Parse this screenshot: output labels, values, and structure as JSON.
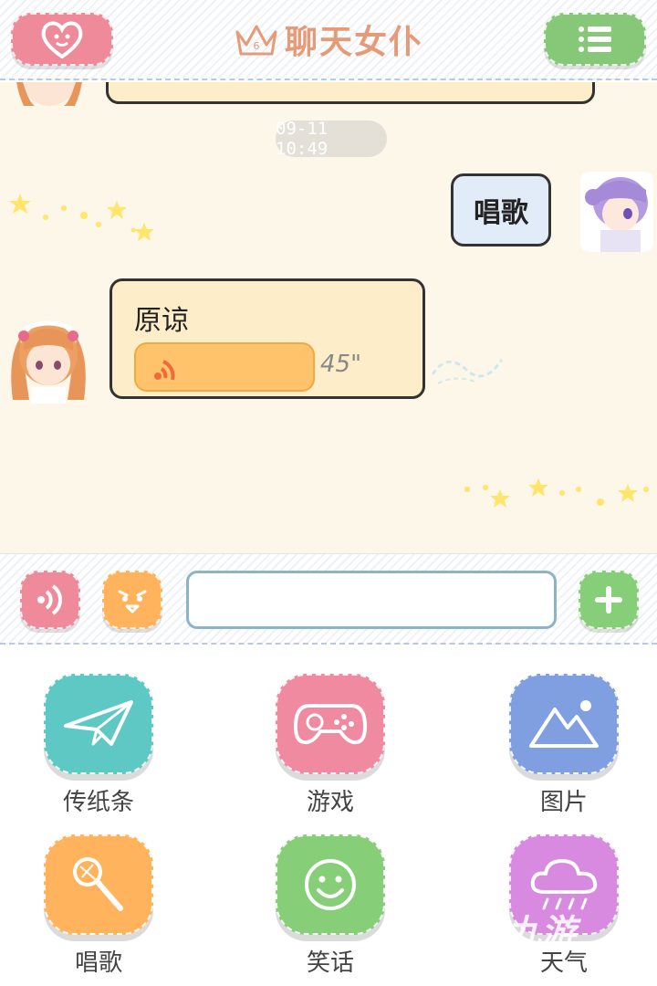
{
  "header": {
    "title": "聊天女仆",
    "crown_number": "6",
    "left_button_icon": "heart-face-icon",
    "right_button_icon": "menu-list-icon"
  },
  "chat": {
    "timestamp": "09-11 10:49",
    "messages": [
      {
        "from": "user",
        "text": "唱歌"
      },
      {
        "from": "maid",
        "text": "原谅",
        "voice_duration": "45\""
      }
    ]
  },
  "input_bar": {
    "voice_icon": "voice-wave-icon",
    "emoji_icon": "smiley-face-icon",
    "input_value": "",
    "plus_icon": "plus-icon"
  },
  "functions": [
    {
      "label": "传纸条",
      "icon": "paper-plane-icon",
      "color": "#5ec8c4"
    },
    {
      "label": "游戏",
      "icon": "gamepad-icon",
      "color": "#f08aa0"
    },
    {
      "label": "图片",
      "icon": "mountain-image-icon",
      "color": "#7f9fe0"
    },
    {
      "label": "唱歌",
      "icon": "microphone-icon",
      "color": "#ffb35c"
    },
    {
      "label": "笑话",
      "icon": "smiley-icon",
      "color": "#86cf78"
    },
    {
      "label": "天气",
      "icon": "cloud-rain-icon",
      "color": "#d88ae0"
    }
  ],
  "watermark": "九游",
  "colors": {
    "chat_background": "#fdf7ea",
    "maid_bubble": "#fdeec9",
    "user_bubble": "#e1ecf8",
    "title": "#e79a78"
  }
}
